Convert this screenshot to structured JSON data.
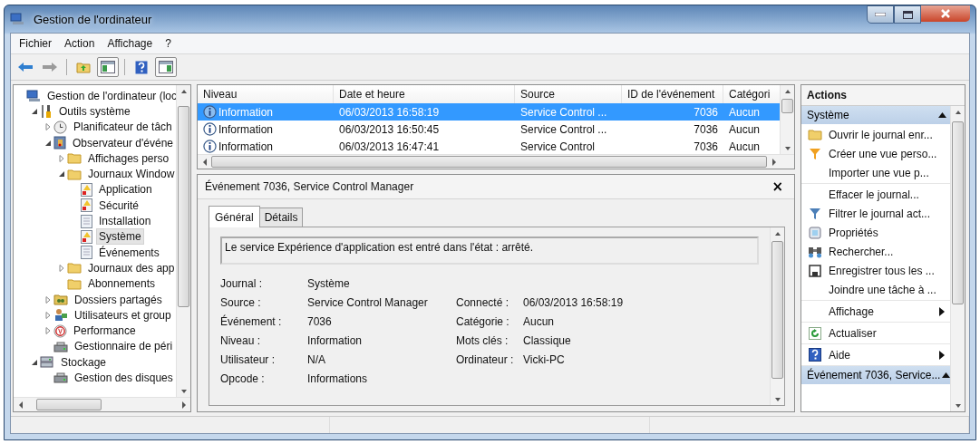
{
  "window": {
    "title": "Gestion de l'ordinateur"
  },
  "menu": [
    "Fichier",
    "Action",
    "Affichage",
    "?"
  ],
  "toolbar": [
    {
      "kind": "back",
      "disabled": false
    },
    {
      "kind": "forward",
      "disabled": true
    },
    {
      "kind": "up",
      "disabled": false
    },
    {
      "kind": "tree-pane",
      "disabled": false
    },
    {
      "kind": "help",
      "disabled": false
    },
    {
      "kind": "action-pane",
      "disabled": false
    }
  ],
  "tree": [
    {
      "label": "Gestion de l'ordinateur (loc",
      "kind": "computer",
      "selected": false,
      "children": [
        {
          "label": "Outils système",
          "kind": "tools",
          "expanded": true,
          "selected": false,
          "children": [
            {
              "label": "Planificateur de tâch",
              "kind": "clock",
              "expanded": false,
              "selected": false
            },
            {
              "label": "Observateur d'événe",
              "kind": "viewer",
              "expanded": true,
              "selected": false,
              "children": [
                {
                  "label": "Affichages perso",
                  "kind": "folder",
                  "expanded": false,
                  "selected": false
                },
                {
                  "label": "Journaux Window",
                  "kind": "folder",
                  "expanded": true,
                  "selected": false,
                  "children": [
                    {
                      "label": "Application",
                      "kind": "log-warn",
                      "selected": false
                    },
                    {
                      "label": "Sécurité",
                      "kind": "log-warn",
                      "selected": false
                    },
                    {
                      "label": "Installation",
                      "kind": "log",
                      "selected": false
                    },
                    {
                      "label": "Système",
                      "kind": "log-warn",
                      "selected": true
                    },
                    {
                      "label": "Événements",
                      "kind": "log",
                      "selected": false
                    }
                  ]
                },
                {
                  "label": "Journaux des app",
                  "kind": "folder",
                  "expanded": false,
                  "selected": false
                },
                {
                  "label": "Abonnements",
                  "kind": "folder",
                  "selected": false
                }
              ]
            },
            {
              "label": "Dossiers partagés",
              "kind": "shared",
              "expanded": false,
              "selected": false
            },
            {
              "label": "Utilisateurs et group",
              "kind": "users",
              "expanded": false,
              "selected": false
            },
            {
              "label": "Performance",
              "kind": "performance",
              "expanded": false,
              "selected": false
            },
            {
              "label": "Gestionnaire de péri",
              "kind": "device",
              "selected": false
            }
          ]
        },
        {
          "label": "Stockage",
          "kind": "storage",
          "expanded": true,
          "selected": false,
          "children": [
            {
              "label": "Gestion des disques",
              "kind": "disk",
              "selected": false
            }
          ]
        }
      ]
    }
  ],
  "table": {
    "columns": [
      "Niveau",
      "Date et heure",
      "Source",
      "ID de l'événement",
      "Catégori"
    ],
    "rows": [
      {
        "level": "Information",
        "date": "06/03/2013 16:58:19",
        "source": "Service Control ...",
        "id": "7036",
        "category": "Aucun",
        "selected": true
      },
      {
        "level": "Information",
        "date": "06/03/2013 16:50:45",
        "source": "Service Control ...",
        "id": "7036",
        "category": "Aucun",
        "selected": false
      },
      {
        "level": "Information",
        "date": "06/03/2013 16:47:41",
        "source": "Service Control",
        "id": "7036",
        "category": "Aucun",
        "selected": false
      }
    ]
  },
  "detail": {
    "title": "Événement 7036, Service Control Manager",
    "close": "×",
    "tabs": [
      {
        "label": "Général",
        "selected": true
      },
      {
        "label": "Détails",
        "selected": false
      }
    ],
    "message": "Le service Expérience d'application est entré dans l'état : arrêté.",
    "rows": [
      [
        {
          "label": "Journal :",
          "value": "Système"
        }
      ],
      [
        {
          "label": "Source :",
          "value": "Service Control Manager"
        },
        {
          "label": "Connecté :",
          "value": "06/03/2013 16:58:19"
        }
      ],
      [
        {
          "label": "Événement :",
          "value": "7036"
        },
        {
          "label": "Catégorie :",
          "value": "Aucun"
        }
      ],
      [
        {
          "label": "Niveau :",
          "value": "Information"
        },
        {
          "label": "Mots clés :",
          "value": "Classique"
        }
      ],
      [
        {
          "label": "Utilisateur :",
          "value": "N/A"
        },
        {
          "label": "Ordinateur :",
          "value": "Vicki-PC"
        }
      ],
      [
        {
          "label": "Opcode :",
          "value": "Informations"
        }
      ]
    ]
  },
  "actions": {
    "title": "Actions",
    "sections": [
      {
        "title": "Système",
        "expanded": true,
        "groups": [
          [
            {
              "label": "Ouvrir le journal enr...",
              "kind": "open-folder",
              "submenu": false
            },
            {
              "label": "Créer une vue perso...",
              "kind": "funnel-create",
              "submenu": false
            },
            {
              "label": "Importer une vue p...",
              "kind": "none",
              "submenu": false
            }
          ],
          [
            {
              "label": "Effacer le journal...",
              "kind": "none",
              "submenu": false
            },
            {
              "label": "Filtrer le journal act...",
              "kind": "funnel",
              "submenu": false
            },
            {
              "label": "Propriétés",
              "kind": "properties",
              "submenu": false
            },
            {
              "label": "Rechercher...",
              "kind": "binoculars",
              "submenu": false
            },
            {
              "label": "Enregistrer tous les ...",
              "kind": "floppy",
              "submenu": false
            },
            {
              "label": "Joindre une tâche à ...",
              "kind": "none",
              "submenu": false
            }
          ],
          [
            {
              "label": "Affichage",
              "kind": "none",
              "submenu": true
            }
          ],
          [
            {
              "label": "Actualiser",
              "kind": "refresh",
              "submenu": false
            }
          ],
          [
            {
              "label": "Aide",
              "kind": "help",
              "submenu": true
            }
          ]
        ]
      },
      {
        "title": "Événement 7036, Service...",
        "expanded": true
      }
    ]
  }
}
